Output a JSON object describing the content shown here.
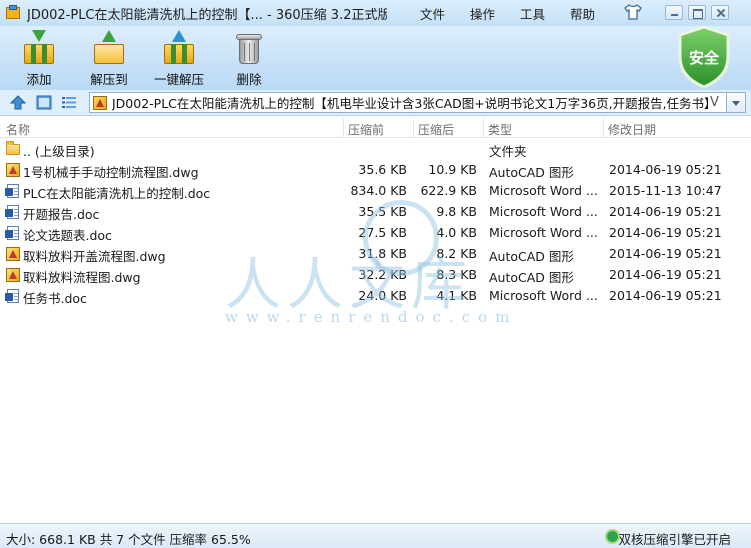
{
  "window": {
    "title": "JD002-PLC在太阳能清洗机上的控制【... - 360压缩 3.2正式版"
  },
  "menu": {
    "items": [
      "文件",
      "操作",
      "工具",
      "帮助"
    ]
  },
  "toolbar": {
    "add_label": "添加",
    "extract_label": "解压到",
    "oneclick_label": "一键解压",
    "delete_label": "删除",
    "security_label": "安全"
  },
  "address": {
    "path": "JD002-PLC在太阳能清洗机上的控制【机电毕业设计含3张CAD图+说明书论文1万字36页,开题报告,任务书】.zip",
    "suffix": "V"
  },
  "columns": {
    "name": "名称",
    "size": "压缩前",
    "packed": "压缩后",
    "type": "类型",
    "date": "修改日期"
  },
  "files": [
    {
      "name": ".. (上级目录)",
      "size": "",
      "packed": "",
      "type": "文件夹",
      "date": "",
      "icon": "folder-icon"
    },
    {
      "name": "1号机械手手动控制流程图.dwg",
      "size": "35.6 KB",
      "packed": "10.9 KB",
      "type": "AutoCAD 图形",
      "date": "2014-06-19 05:21",
      "icon": "dwg-file-icon"
    },
    {
      "name": "PLC在太阳能清洗机上的控制.doc",
      "size": "834.0 KB",
      "packed": "622.9 KB",
      "type": "Microsoft Word ...",
      "date": "2015-11-13 10:47",
      "icon": "doc-file-icon"
    },
    {
      "name": "开题报告.doc",
      "size": "35.5 KB",
      "packed": "9.8 KB",
      "type": "Microsoft Word ...",
      "date": "2014-06-19 05:21",
      "icon": "doc-file-icon"
    },
    {
      "name": "论文选题表.doc",
      "size": "27.5 KB",
      "packed": "4.0 KB",
      "type": "Microsoft Word ...",
      "date": "2014-06-19 05:21",
      "icon": "doc-file-icon"
    },
    {
      "name": "取料放料开盖流程图.dwg",
      "size": "31.8 KB",
      "packed": "8.2 KB",
      "type": "AutoCAD 图形",
      "date": "2014-06-19 05:21",
      "icon": "dwg-file-icon"
    },
    {
      "name": "取料放料流程图.dwg",
      "size": "32.2 KB",
      "packed": "8.3 KB",
      "type": "AutoCAD 图形",
      "date": "2014-06-19 05:21",
      "icon": "dwg-file-icon"
    },
    {
      "name": "任务书.doc",
      "size": "24.0 KB",
      "packed": "4.1 KB",
      "type": "Microsoft Word ...",
      "date": "2014-06-19 05:21",
      "icon": "doc-file-icon"
    }
  ],
  "watermark": {
    "text": "人人文库",
    "url": "www.renrendoc.com"
  },
  "status": {
    "summary": "大小: 668.1 KB 共 7 个文件 压缩率 65.5%",
    "engine": "双核压缩引擎已开启"
  },
  "colors": {
    "accent": "#2f8fd8",
    "security_green": "#3aa43a",
    "titlebar": "#c4e0f7"
  }
}
